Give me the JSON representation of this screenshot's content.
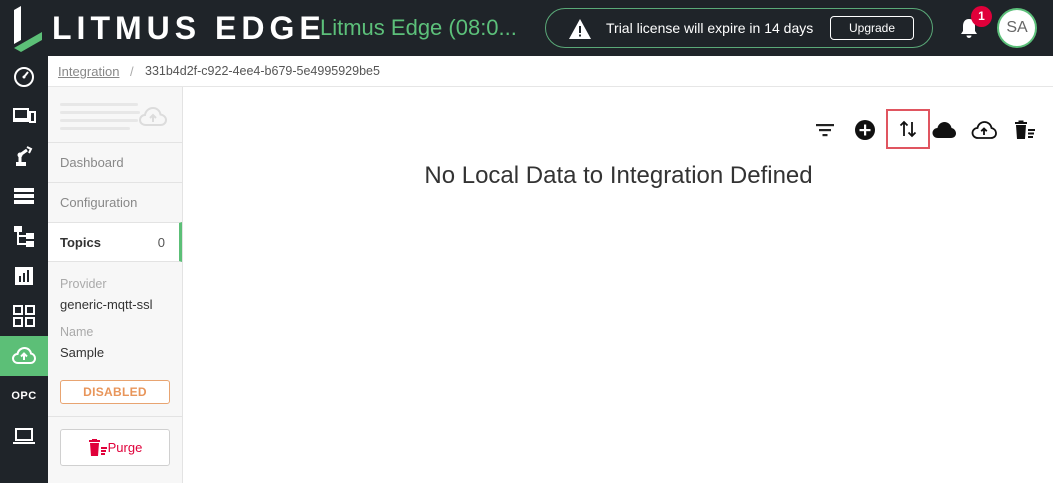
{
  "header": {
    "brand": "LITMUS EDGE",
    "instance": "Litmus Edge (08:0...",
    "trial_message": "Trial license will expire in 14 days",
    "upgrade_label": "Upgrade",
    "notification_count": "1",
    "avatar_initials": "SA"
  },
  "rail": {
    "opc_label": "OPC",
    "active_item": "integration"
  },
  "breadcrumb": {
    "parent": "Integration",
    "separator": "/",
    "current": "331b4d2f-c922-4ee4-b679-5e4995929be5"
  },
  "side": {
    "tabs": [
      {
        "label": "Dashboard"
      },
      {
        "label": "Configuration"
      },
      {
        "label": "Topics",
        "count": "0"
      }
    ],
    "provider_label": "Provider",
    "provider_value": "generic-mqtt-ssl",
    "name_label": "Name",
    "name_value": "Sample",
    "status": "DISABLED",
    "purge_label": "Purge"
  },
  "main": {
    "empty_message": "No Local Data to Integration Defined"
  },
  "colors": {
    "header_bg": "#1f2429",
    "accent_green": "#5cbf77",
    "status_orange": "#e8955a",
    "danger_red": "#e0003a"
  }
}
